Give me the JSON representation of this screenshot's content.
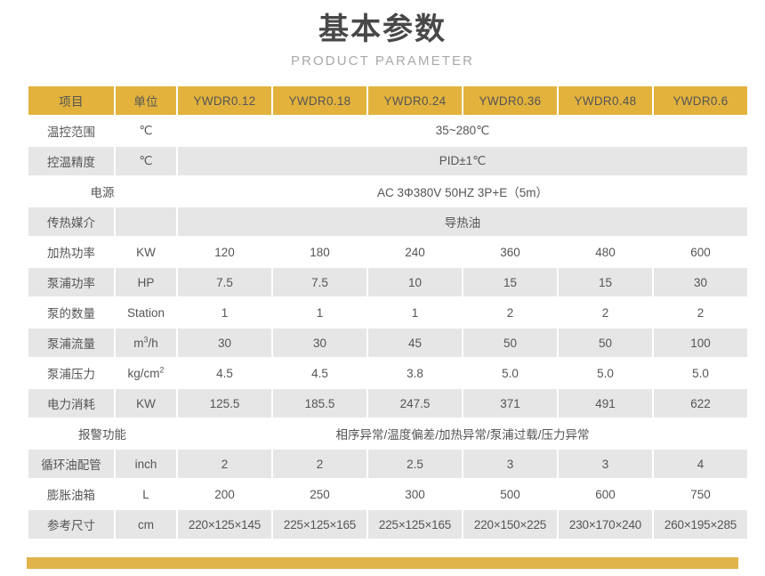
{
  "heading": {
    "title": "基本参数",
    "subtitle": "PRODUCT PARAMETER"
  },
  "theme": {
    "header_bg": "#e2b23c",
    "band_bg": "#e6e6e6",
    "row_bg": "#ffffff",
    "accent_bar": "#e0b34b",
    "title_color": "#484848",
    "subtitle_color": "#a9a9a9",
    "text_color": "#555555"
  },
  "table": {
    "columns": [
      "项目",
      "单位",
      "YWDR0.12",
      "YWDR0.18",
      "YWDR0.24",
      "YWDR0.36",
      "YWDR0.48",
      "YWDR0.6"
    ],
    "rows": [
      {
        "label": "温控范围",
        "unit": "℃",
        "span": "models",
        "value": "35~280℃"
      },
      {
        "label": "控温精度",
        "unit": "℃",
        "span": "models",
        "value": "PID±1℃"
      },
      {
        "label": "电源",
        "unit": "",
        "span": "label-unit-and-models",
        "value": "AC 3Φ380V 50HZ 3P+E（5m）"
      },
      {
        "label": "传热媒介",
        "unit": "",
        "span": "models",
        "value": "导热油"
      },
      {
        "label": "加热功率",
        "unit": "KW",
        "span": "none",
        "values": [
          "120",
          "180",
          "240",
          "360",
          "480",
          "600"
        ]
      },
      {
        "label": "泵浦功率",
        "unit": "HP",
        "span": "none",
        "values": [
          "7.5",
          "7.5",
          "10",
          "15",
          "15",
          "30"
        ]
      },
      {
        "label": "泵的数量",
        "unit": "Station",
        "span": "none",
        "values": [
          "1",
          "1",
          "1",
          "2",
          "2",
          "2"
        ]
      },
      {
        "label": "泵浦流量",
        "unit": "m³/h",
        "unit_base": "m",
        "unit_sup": "3",
        "unit_tail": "/h",
        "span": "none",
        "values": [
          "30",
          "30",
          "45",
          "50",
          "50",
          "100"
        ]
      },
      {
        "label": "泵浦压力",
        "unit": "kg/cm²",
        "unit_base": "kg/cm",
        "unit_sup": "2",
        "unit_tail": "",
        "span": "none",
        "values": [
          "4.5",
          "4.5",
          "3.8",
          "5.0",
          "5.0",
          "5.0"
        ]
      },
      {
        "label": "电力消耗",
        "unit": "KW",
        "span": "none",
        "values": [
          "125.5",
          "185.5",
          "247.5",
          "371",
          "491",
          "622"
        ]
      },
      {
        "label": "报警功能",
        "unit": "",
        "span": "label-unit-and-models",
        "value": "相序异常/温度偏差/加热异常/泵浦过载/压力异常"
      },
      {
        "label": "循环油配管",
        "unit": "inch",
        "span": "none",
        "values": [
          "2",
          "2",
          "2.5",
          "3",
          "3",
          "4"
        ]
      },
      {
        "label": "膨胀油箱",
        "unit": "L",
        "span": "none",
        "values": [
          "200",
          "250",
          "300",
          "500",
          "600",
          "750"
        ]
      },
      {
        "label": "参考尺寸",
        "unit": "cm",
        "span": "none",
        "dimension": true,
        "values": [
          "220×125×145",
          "225×125×165",
          "225×125×165",
          "220×150×225",
          "230×170×240",
          "260×195×285"
        ]
      }
    ]
  }
}
